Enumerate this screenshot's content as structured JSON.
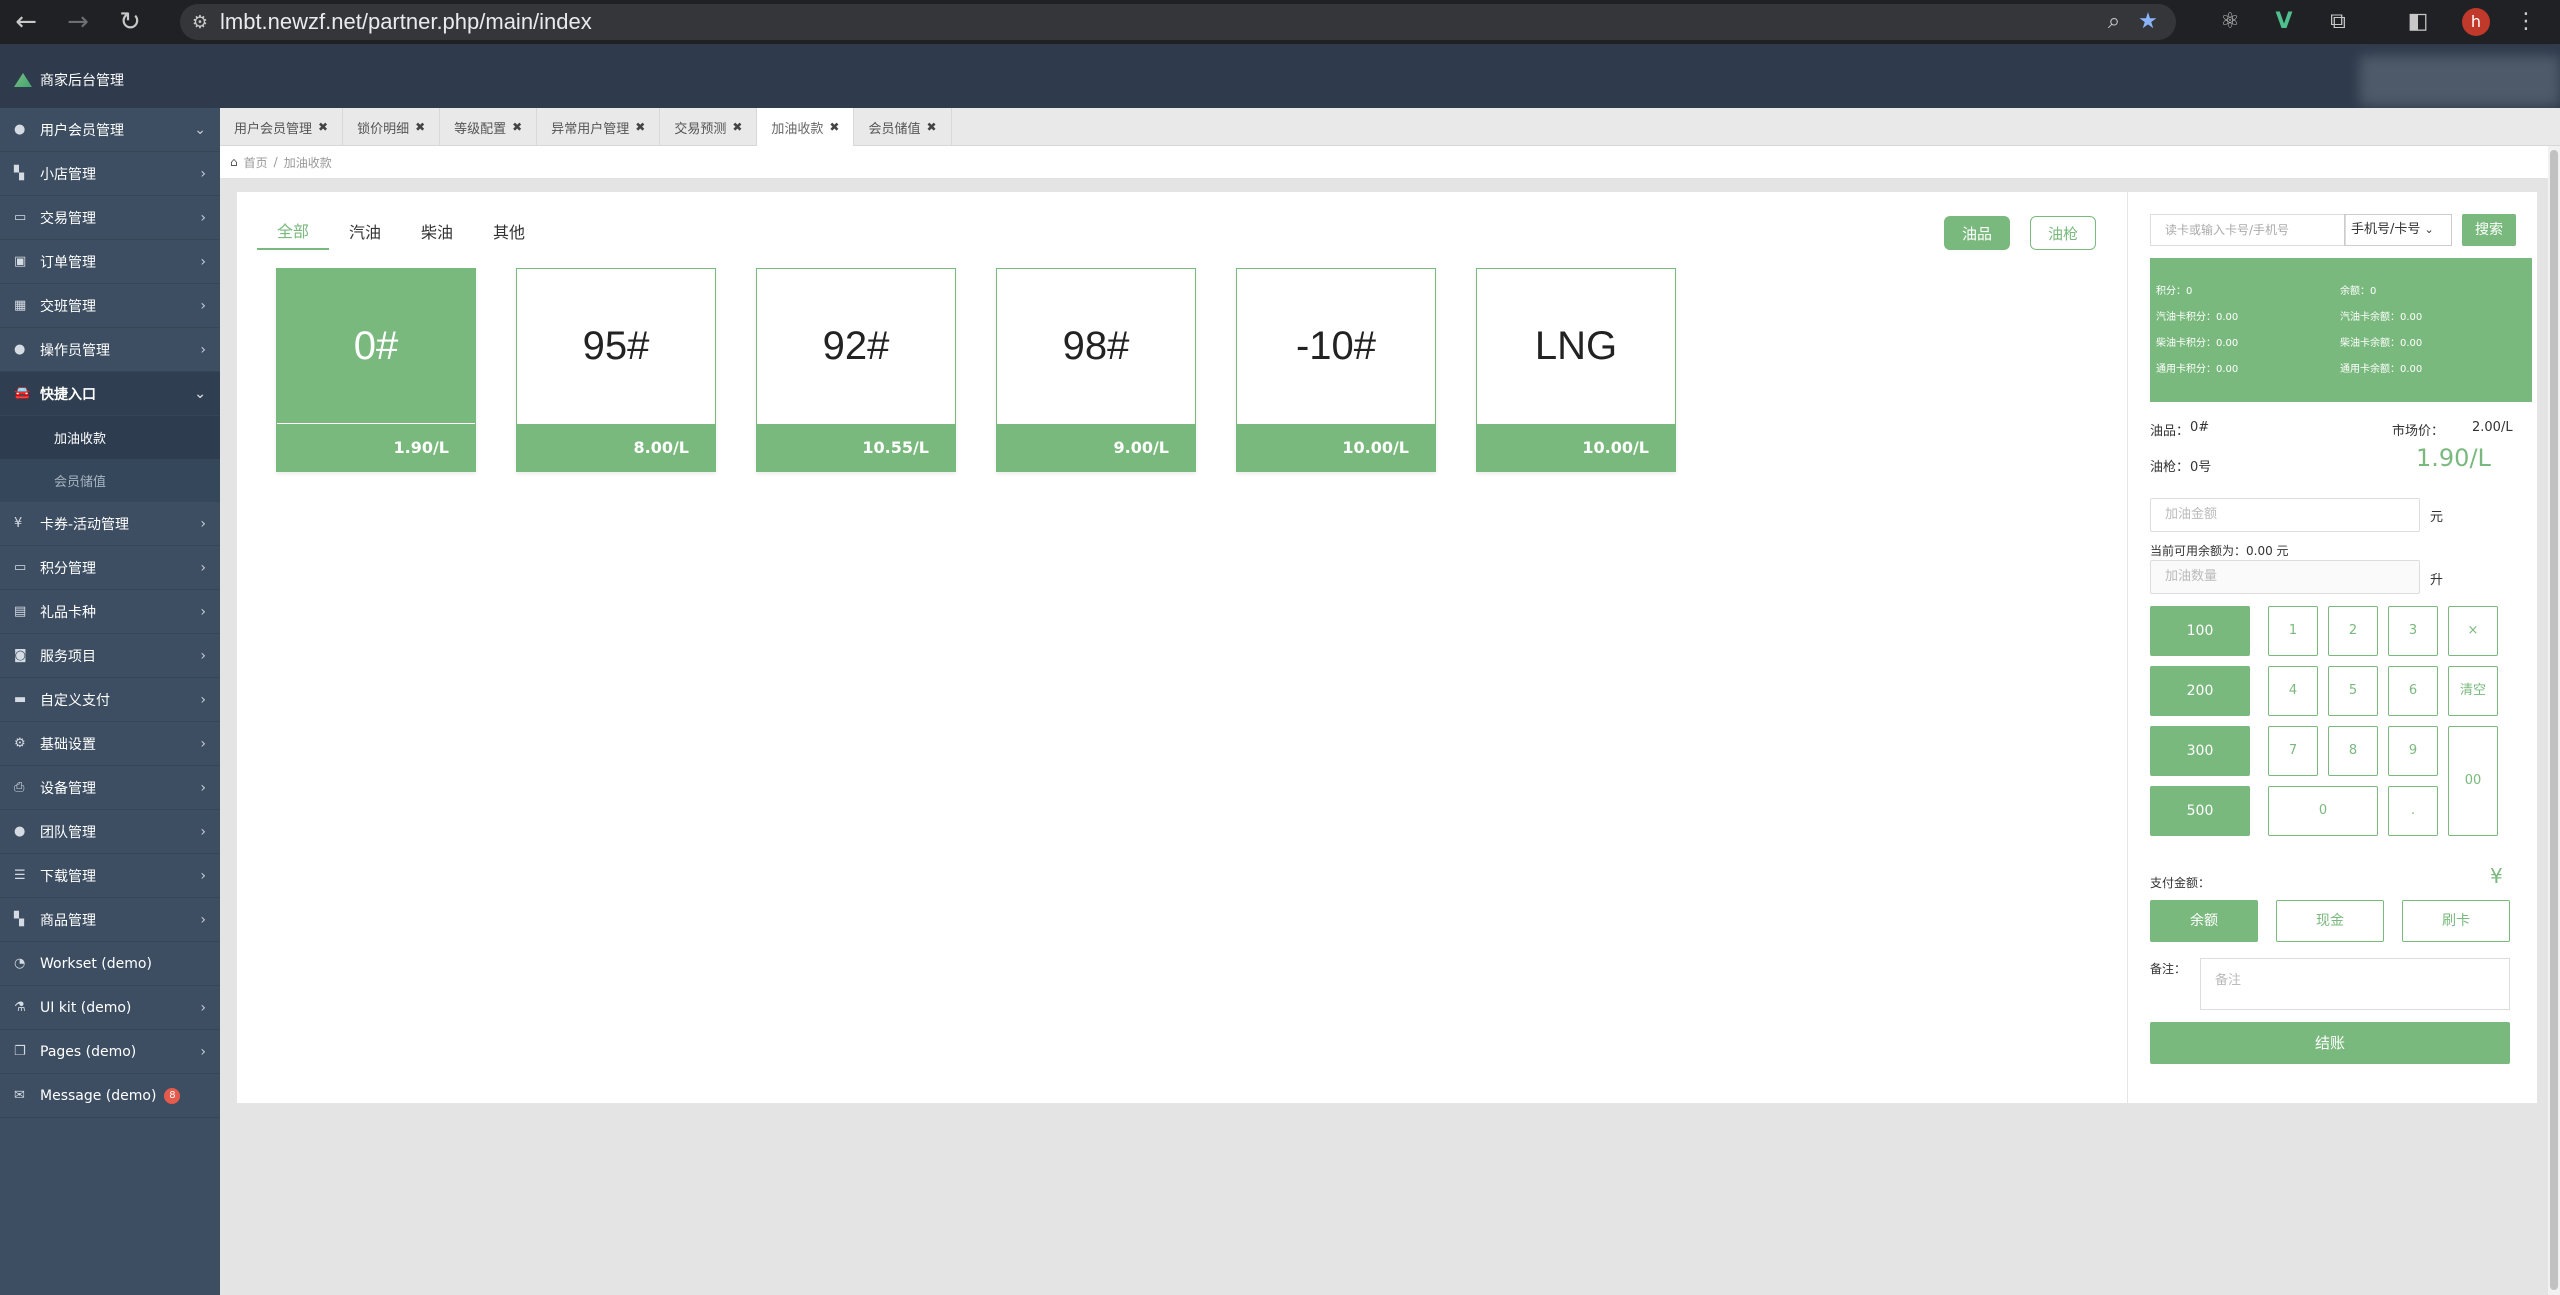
{
  "browser": {
    "url": "lmbt.newzf.net/partner.php/main/index",
    "avatar_letter": "h"
  },
  "app": {
    "title": "商家后台管理"
  },
  "sidebar": {
    "items": [
      {
        "label": "用户会员管理",
        "icon": "user-icon"
      },
      {
        "label": "小店管理",
        "icon": "cart-icon"
      },
      {
        "label": "交易管理",
        "icon": "monitor-icon"
      },
      {
        "label": "订单管理",
        "icon": "order-icon"
      },
      {
        "label": "交班管理",
        "icon": "calendar-icon"
      },
      {
        "label": "操作员管理",
        "icon": "user-icon"
      },
      {
        "label": "快捷入口",
        "icon": "car-icon"
      }
    ],
    "sub_items": [
      "加油收款",
      "会员储值"
    ],
    "items2": [
      {
        "label": "卡券-活动管理",
        "icon": "yen-icon"
      },
      {
        "label": "积分管理",
        "icon": "card-icon"
      },
      {
        "label": "礼品卡种",
        "icon": "gift-icon"
      },
      {
        "label": "服务项目",
        "icon": "service-icon"
      },
      {
        "label": "自定义支付",
        "icon": "payment-icon"
      },
      {
        "label": "基础设置",
        "icon": "gears-icon"
      },
      {
        "label": "设备管理",
        "icon": "printer-icon"
      },
      {
        "label": "团队管理",
        "icon": "user-icon"
      },
      {
        "label": "下载管理",
        "icon": "list-icon"
      },
      {
        "label": "商品管理",
        "icon": "cart-icon"
      },
      {
        "label": "Workset (demo)",
        "icon": "dashboard-icon"
      },
      {
        "label": "UI kit (demo)",
        "icon": "flask-icon"
      },
      {
        "label": "Pages (demo)",
        "icon": "pages-icon"
      },
      {
        "label": "Message (demo)",
        "icon": "mail-icon",
        "badge": "8"
      }
    ]
  },
  "tabs": [
    {
      "label": "用户会员管理"
    },
    {
      "label": "锁价明细"
    },
    {
      "label": "等级配置"
    },
    {
      "label": "异常用户管理"
    },
    {
      "label": "交易预测"
    },
    {
      "label": "加油收款"
    },
    {
      "label": "会员储值"
    }
  ],
  "breadcrumb": {
    "home": "首页",
    "current": "加油收款"
  },
  "filter_tabs": [
    "全部",
    "汽油",
    "柴油",
    "其他"
  ],
  "top_buttons": {
    "fuel": "油品",
    "nozzle": "油枪"
  },
  "fuels": [
    {
      "name": "0#",
      "price": "1.90/L"
    },
    {
      "name": "95#",
      "price": "8.00/L"
    },
    {
      "name": "92#",
      "price": "10.55/L"
    },
    {
      "name": "98#",
      "price": "9.00/L"
    },
    {
      "name": "-10#",
      "price": "10.00/L"
    },
    {
      "name": "LNG",
      "price": "10.00/L"
    }
  ],
  "right_panel": {
    "search_placeholder": "读卡或输入卡号/手机号",
    "search_type": "手机号/卡号",
    "search_button": "搜索",
    "info": {
      "points": "积分：0",
      "balance": "余额：0",
      "gas_points": "汽油卡积分：0.00",
      "gas_balance": "汽油卡余额：0.00",
      "diesel_points": "柴油卡积分：0.00",
      "diesel_balance": "柴油卡余额：0.00",
      "general_points": "通用卡积分：0.00",
      "general_balance": "通用卡余额：0.00"
    },
    "product_label": "油品：",
    "product_value": "0#",
    "market_label": "市场价：",
    "market_value": "2.00/L",
    "nozzle_label": "油枪：",
    "nozzle_value": "0号",
    "unit_price": "1.90/L",
    "amount_placeholder": "加油金额",
    "amount_unit": "元",
    "available_balance": "当前可用余额为：0.00 元",
    "quantity_placeholder": "加油数量",
    "quantity_unit": "升",
    "quick_amounts": [
      "100",
      "200",
      "300",
      "500"
    ],
    "keys": [
      "1",
      "2",
      "3",
      "×",
      "4",
      "5",
      "6",
      "清空",
      "7",
      "8",
      "9",
      "00",
      "0",
      "."
    ],
    "pay_amount_label": "支付金额：",
    "currency": "¥",
    "pay_methods": [
      "余额",
      "现金",
      "刷卡"
    ],
    "remark_label": "备注：",
    "remark_placeholder": "备注",
    "checkout": "结账"
  },
  "colors": {
    "accent": "#7ab97d",
    "sidebar": "#3d4e62",
    "header": "#2f3b4c"
  }
}
